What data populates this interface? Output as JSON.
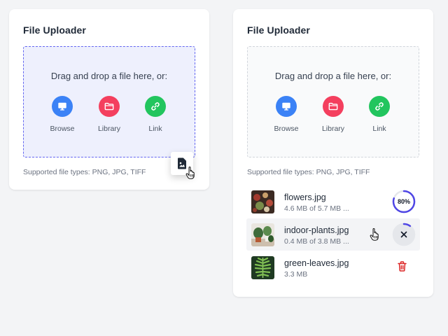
{
  "uploader_left": {
    "title": "File Uploader",
    "dropzone_text": "Drag and drop a file here, or:",
    "buttons": [
      {
        "label": "Browse",
        "icon": "monitor-icon",
        "color": "#3b82f6"
      },
      {
        "label": "Library",
        "icon": "folder-icon",
        "color": "#f43f5e"
      },
      {
        "label": "Link",
        "icon": "link-icon",
        "color": "#22c55e"
      }
    ],
    "supported_types": "Supported file types: PNG, JPG, TIFF",
    "dragging_icon": "file-image-icon",
    "accent": "#6366f1"
  },
  "uploader_right": {
    "title": "File Uploader",
    "dropzone_text": "Drag and drop a file here, or:",
    "buttons": [
      {
        "label": "Browse",
        "icon": "monitor-icon",
        "color": "#3b82f6"
      },
      {
        "label": "Library",
        "icon": "folder-icon",
        "color": "#f43f5e"
      },
      {
        "label": "Link",
        "icon": "link-icon",
        "color": "#22c55e"
      }
    ],
    "supported_types": "Supported file types: PNG, JPG, TIFF",
    "files": [
      {
        "name": "flowers.jpg",
        "meta": "4.6 MB of 5.7 MB ...",
        "status": "uploading",
        "progress_label": "80%",
        "progress": 0.8
      },
      {
        "name": "indoor-plants.jpg",
        "meta": "0.4 MB of 3.8 MB ...",
        "status": "uploading-hover",
        "progress": 0.1
      },
      {
        "name": "green-leaves.jpg",
        "meta": "3.3 MB",
        "status": "complete"
      }
    ],
    "progress_color": "#4f46e5",
    "delete_color": "#dc2626"
  }
}
